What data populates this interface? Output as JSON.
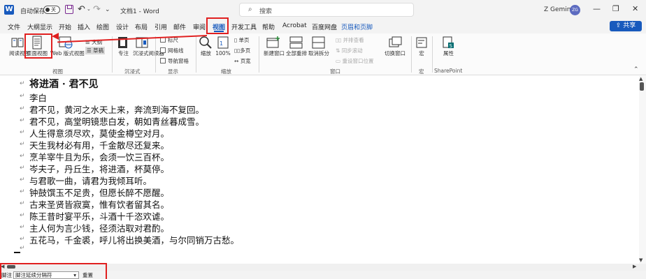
{
  "titlebar": {
    "autosave_label": "自动保存",
    "autosave_state": "关",
    "doc_title": "文档1 - Word",
    "search_placeholder": "搜索",
    "user_name": "Z Gemini",
    "user_initials": "ZG",
    "min": "—",
    "restore": "❐",
    "close": "✕"
  },
  "menu": {
    "items": [
      "文件",
      "大纲显示",
      "开始",
      "插入",
      "绘图",
      "设计",
      "布局",
      "引用",
      "邮件",
      "审阅",
      "视图",
      "开发工具",
      "帮助",
      "Acrobat",
      "百度网盘",
      "页眉和页脚"
    ],
    "active": "视图",
    "share": "共享"
  },
  "ribbon": {
    "views": {
      "read": "阅读视图",
      "page": "页面视图",
      "web": "Web 版式视图",
      "outline": "大纲",
      "draft": "草稿",
      "group": "视图"
    },
    "immersive": {
      "focus": "专注",
      "reader": "沉浸式阅读器",
      "group": "沉浸式"
    },
    "show": {
      "ruler": "标尺",
      "grid": "网格线",
      "nav": "导航窗格",
      "group": "显示"
    },
    "zoom": {
      "zoom": "缩放",
      "hundred": "100%",
      "one_page": "单页",
      "multi": "多页",
      "page_width": "页宽",
      "group": "缩放"
    },
    "window": {
      "new": "新建窗口",
      "arrange": "全部重排",
      "split": "取消拆分",
      "side_by_side": "并排查看",
      "sync_scroll": "同步滚动",
      "reset_pos": "重设窗口位置",
      "switch": "切换窗口",
      "group": "窗口"
    },
    "macros": {
      "macro": "宏",
      "group": "宏"
    },
    "sharepoint": {
      "props": "属性",
      "group": "SharePoint"
    }
  },
  "document": {
    "title": "将进酒 · 君不见",
    "author": "李白",
    "lines": [
      "君不见，黄河之水天上来，奔流到海不复回。",
      "君不见，高堂明镜悲白发，朝如青丝暮成雪。",
      "人生得意须尽欢，莫使金樽空对月。",
      "天生我材必有用，千金散尽还复来。",
      "烹羊宰牛且为乐，会须一饮三百杯。",
      "岑夫子，丹丘生，将进酒，杯莫停。",
      "与君歌一曲，请君为我倾耳听。",
      "钟鼓馔玉不足贵，但愿长醉不愿醒。",
      "古来圣贤皆寂寞，惟有饮者留其名。",
      "陈王昔时宴平乐，斗酒十千恣欢谑。",
      "主人何为言少钱，径须沽取对君酌。",
      "五花马，千金裘，呼儿将出换美酒，与尔同销万古愁。"
    ],
    "para_mark": "↵"
  },
  "statusbar": {
    "footnote_label": "脚注",
    "dropdown_value": "脚注延续分隔符",
    "reset": "重置"
  }
}
